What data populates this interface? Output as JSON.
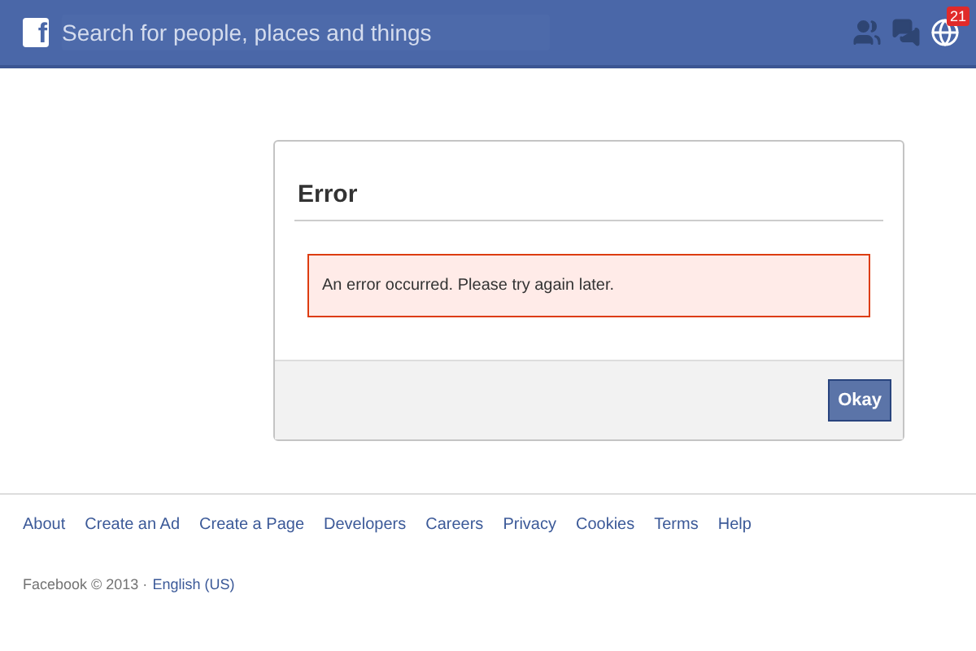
{
  "top_bar": {
    "logo": "f",
    "search": {
      "placeholder": "Search for people, places and things"
    },
    "notifications": {
      "count": "21"
    }
  },
  "dialog": {
    "title": "Error",
    "message": "An error occurred. Please try again later.",
    "button": "Okay"
  },
  "footer": {
    "links": [
      "About",
      "Create an Ad",
      "Create a Page",
      "Developers",
      "Careers",
      "Privacy",
      "Cookies",
      "Terms",
      "Help"
    ],
    "copyright": "Facebook © 2013 ·",
    "language": "English (US)"
  }
}
